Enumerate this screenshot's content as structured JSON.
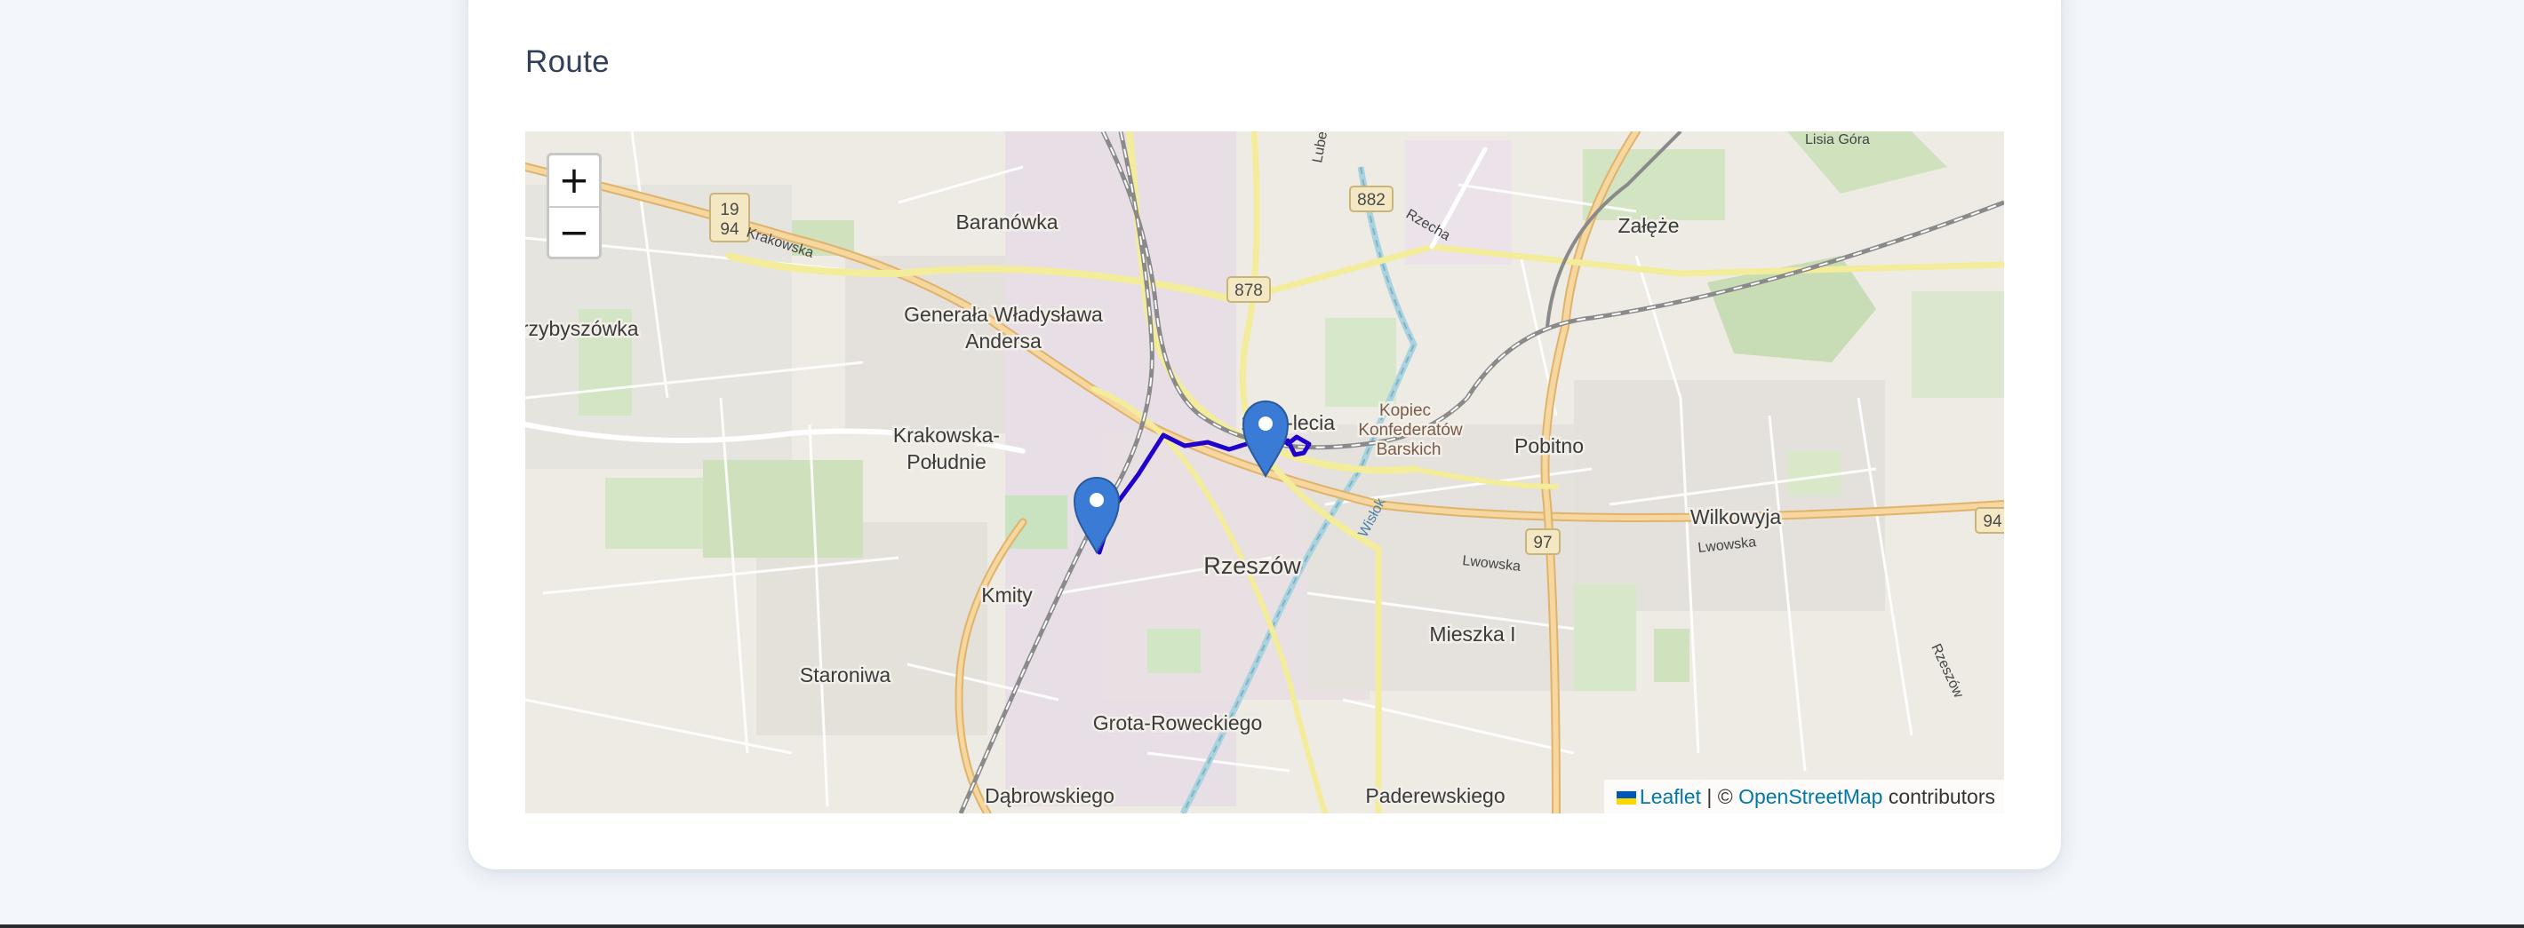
{
  "section": {
    "title": "Route"
  },
  "map": {
    "zoom_in_label": "+",
    "zoom_out_label": "−",
    "attribution": {
      "leaflet_label": "Leaflet",
      "separator": " | © ",
      "osm_label": "OpenStreetMap",
      "suffix": " contributors",
      "flag_colors": [
        "#0057b7",
        "#ffd700"
      ]
    },
    "place_labels": {
      "baranowka": "Baranówka",
      "zaleze": "Załęże",
      "przybyszowka": "Przybyszówka",
      "andersa_1": "Generała Władysława",
      "andersa_2": "Andersa",
      "tysiaclecia": "1000-lecia",
      "kopiec_1": "Kopiec",
      "kopiec_2": "Konfederatów",
      "kopiec_3": "Barskich",
      "pobitno": "Pobitno",
      "krakowska_1": "Krakowska-",
      "krakowska_2": "Południe",
      "wilkowyja": "Wilkowyja",
      "rzeszow": "Rzeszów",
      "kmity": "Kmity",
      "mieszka": "Mieszka I",
      "staroniwa": "Staroniwa",
      "grota": "Grota-Roweckiego",
      "dabrowskiego": "Dąbrowskiego",
      "paderewskiego": "Paderewskiego"
    },
    "street_labels": {
      "krakowska": "Krakowska",
      "rzecha": "Rzecha",
      "lubelska": "Lubelska",
      "lwowska_1": "Lwowska",
      "lwowska_2": "Lwowska",
      "wislok": "Wisłok",
      "rzeszowska": "Rzeszów",
      "lisi": "Lisia Góra"
    },
    "road_shields": {
      "r1994_top": "19",
      "r1994_bottom": "94",
      "r882": "882",
      "r878": "878",
      "r97": "97",
      "r94": "94"
    },
    "route_color": "#2200cc",
    "marker_color": "#3a7bd5",
    "markers": [
      "start",
      "end"
    ]
  }
}
